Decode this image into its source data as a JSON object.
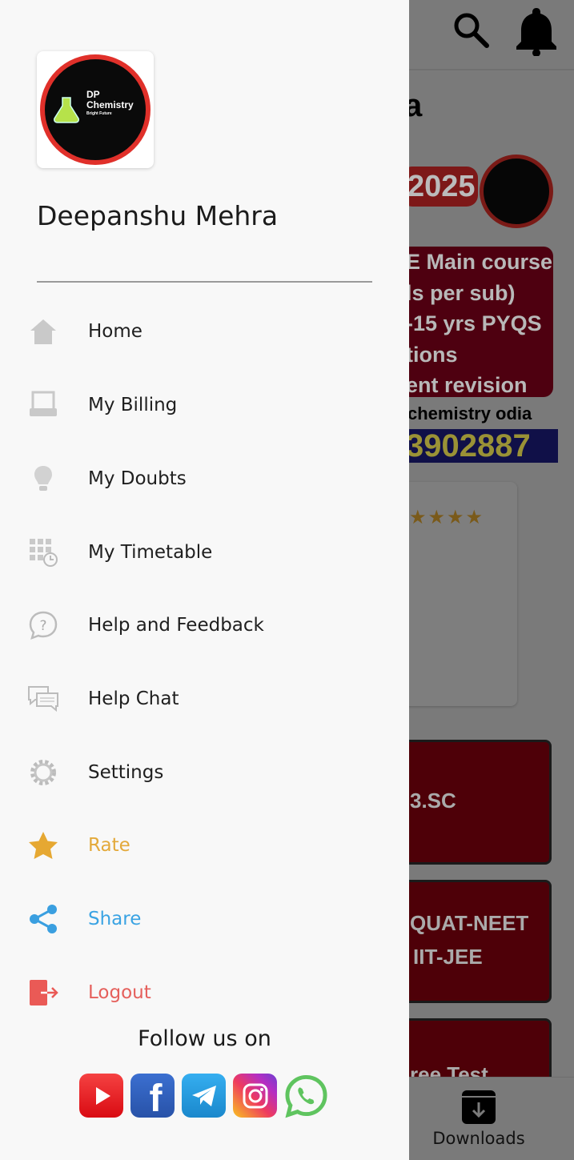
{
  "drawer": {
    "logo_text": {
      "line1": "DP",
      "line2": "Chemistry",
      "tagline": "Bright Future"
    },
    "user_name": "Deepanshu Mehra",
    "menu": [
      {
        "label": "Home",
        "icon": "home-icon",
        "color": "#1f1f1f"
      },
      {
        "label": "My Billing",
        "icon": "billing-icon",
        "color": "#1f1f1f"
      },
      {
        "label": "My Doubts",
        "icon": "lightbulb-icon",
        "color": "#1f1f1f"
      },
      {
        "label": "My Timetable",
        "icon": "timetable-icon",
        "color": "#1f1f1f"
      },
      {
        "label": "Help and Feedback",
        "icon": "help-icon",
        "color": "#1f1f1f"
      },
      {
        "label": "Help Chat",
        "icon": "chat-icon",
        "color": "#1f1f1f"
      },
      {
        "label": "Settings",
        "icon": "gear-icon",
        "color": "#1f1f1f"
      },
      {
        "label": "Rate",
        "icon": "star-icon",
        "color": "#e3a93a"
      },
      {
        "label": "Share",
        "icon": "share-icon",
        "color": "#3aa3e3"
      },
      {
        "label": "Logout",
        "icon": "logout-icon",
        "color": "#e5605c"
      }
    ],
    "follow_label": "Follow us on",
    "social": [
      "youtube",
      "facebook",
      "telegram",
      "instagram",
      "whatsapp"
    ]
  },
  "background": {
    "title_fragment": "a",
    "banner_year": "2025",
    "banner_lines": [
      "E Main course",
      "ls per sub)",
      "-15  yrs  PYQS",
      "tions",
      "ent revision"
    ],
    "channel": "chemistry odia",
    "phone": "3902887",
    "cards": [
      "3.SC",
      "QUAT-NEET",
      "IIT-JEE",
      "ree Test"
    ],
    "bottom_nav": "Downloads"
  }
}
